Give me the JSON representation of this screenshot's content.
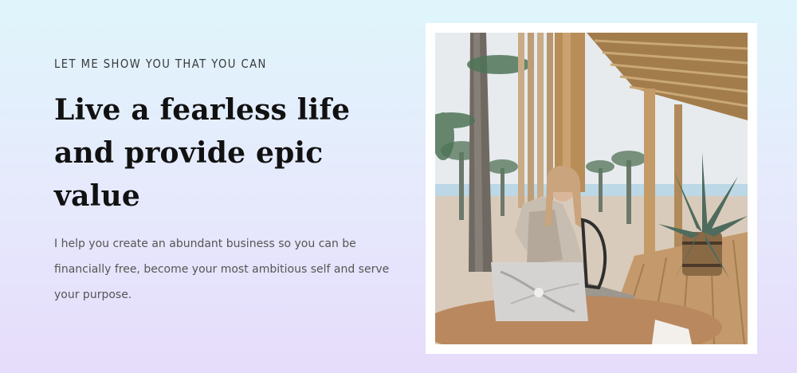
{
  "hero": {
    "eyebrow": "LET ME SHOW YOU THAT YOU CAN",
    "headline": "Live a fearless life and provide epic value",
    "body": "I help you create an abundant business so you can be financially free, become your most ambitious self and serve your purpose."
  },
  "colors": {
    "bg_top": "#dff5fb",
    "bg_bottom": "#e6dcfb",
    "heading": "#111111",
    "body": "#555555"
  }
}
